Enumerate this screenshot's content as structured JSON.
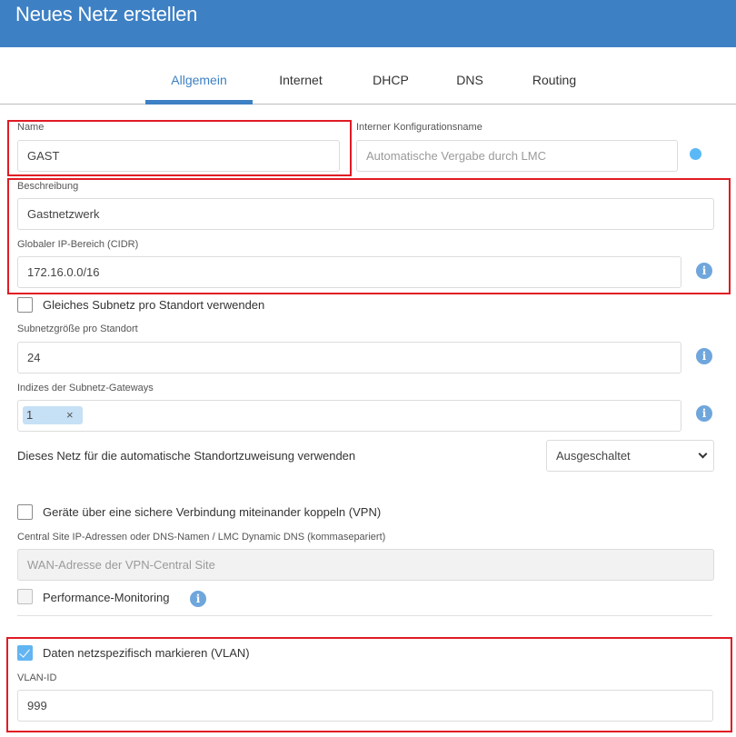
{
  "header": {
    "title": "Neues Netz erstellen"
  },
  "tabs": [
    {
      "label": "Allgemein",
      "active": true
    },
    {
      "label": "Internet",
      "active": false
    },
    {
      "label": "DHCP",
      "active": false
    },
    {
      "label": "DNS",
      "active": false
    },
    {
      "label": "Routing",
      "active": false
    }
  ],
  "form": {
    "name": {
      "label": "Name",
      "value": "GAST"
    },
    "internal_name": {
      "label": "Interner Konfigurationsname",
      "placeholder": "Automatische Vergabe durch LMC"
    },
    "description": {
      "label": "Beschreibung",
      "value": "Gastnetzwerk"
    },
    "ip_range": {
      "label": "Globaler IP-Bereich (CIDR)",
      "value": "172.16.0.0/16"
    },
    "same_subnet": {
      "label": "Gleiches Subnetz pro Standort verwenden",
      "checked": false
    },
    "subnet_size": {
      "label": "Subnetzgröße pro Standort",
      "value": "24"
    },
    "gateway_indices": {
      "label": "Indizes der Subnetz-Gateways",
      "tags": [
        "1"
      ],
      "remove_symbol": "×"
    },
    "auto_assign": {
      "label": "Dieses Netz für die automatische Standortzuweisung verwenden",
      "selected": "Ausgeschaltet"
    },
    "vpn": {
      "label": "Geräte über eine sichere Verbindung miteinander koppeln (VPN)",
      "checked": false
    },
    "central_site": {
      "label": "Central Site IP-Adressen oder DNS-Namen / LMC Dynamic DNS (kommasepariert)",
      "placeholder": "WAN-Adresse der VPN-Central Site"
    },
    "performance_monitoring": {
      "label": "Performance-Monitoring",
      "checked": false
    },
    "vlan_tagging": {
      "label": "Daten netzspezifisch markieren (VLAN)",
      "checked": true
    },
    "vlan_id": {
      "label": "VLAN-ID",
      "value": "999"
    }
  },
  "icons": {
    "info": "i"
  },
  "colors": {
    "header": "#3d80c4",
    "accent": "#3d80c4",
    "highlight": "#e01b24",
    "info_icon": "#6fa6dc",
    "checkbox_checked": "#63b5f2",
    "tag_bg": "#c6e0f5"
  }
}
